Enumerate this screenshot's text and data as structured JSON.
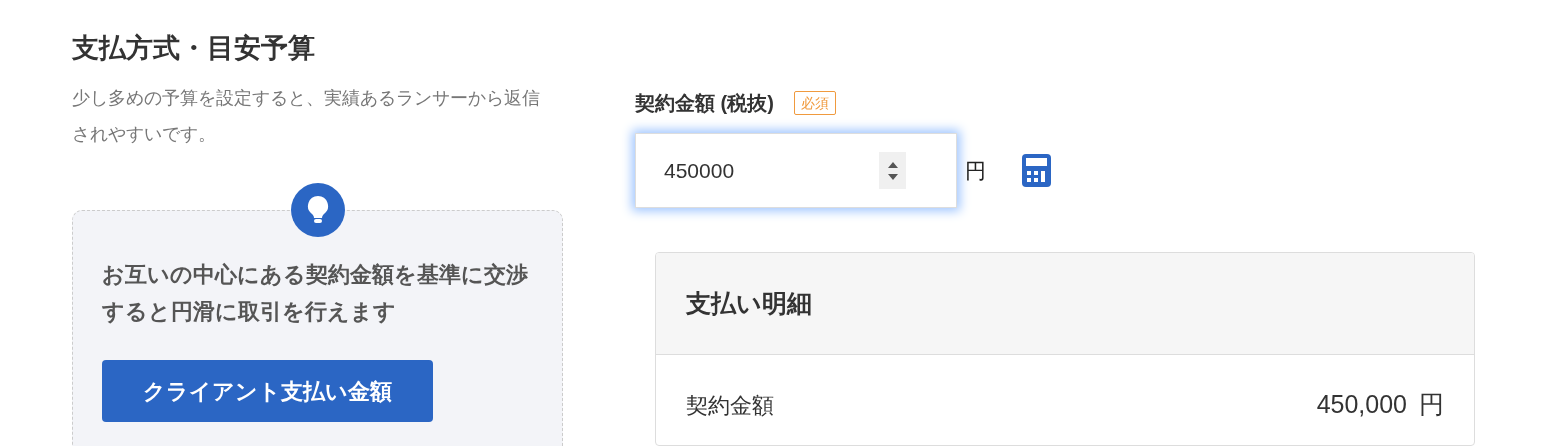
{
  "section": {
    "title": "支払方式・目安予算",
    "description": "少し多めの予算を設定すると、実績あるランサーから返信されやすいです。"
  },
  "tip": {
    "text": "お互いの中心にある契約金額を基準に交渉すると円滑に取引を行えます",
    "button": "クライアント支払い金額"
  },
  "amount_field": {
    "label": "契約金額 (税抜)",
    "badge": "必須",
    "value": "450000",
    "unit": "円",
    "focused": true
  },
  "payment_details": {
    "title": "支払い明細",
    "rows": [
      {
        "label": "契約金額",
        "value": "450,000",
        "unit": "円"
      }
    ]
  }
}
